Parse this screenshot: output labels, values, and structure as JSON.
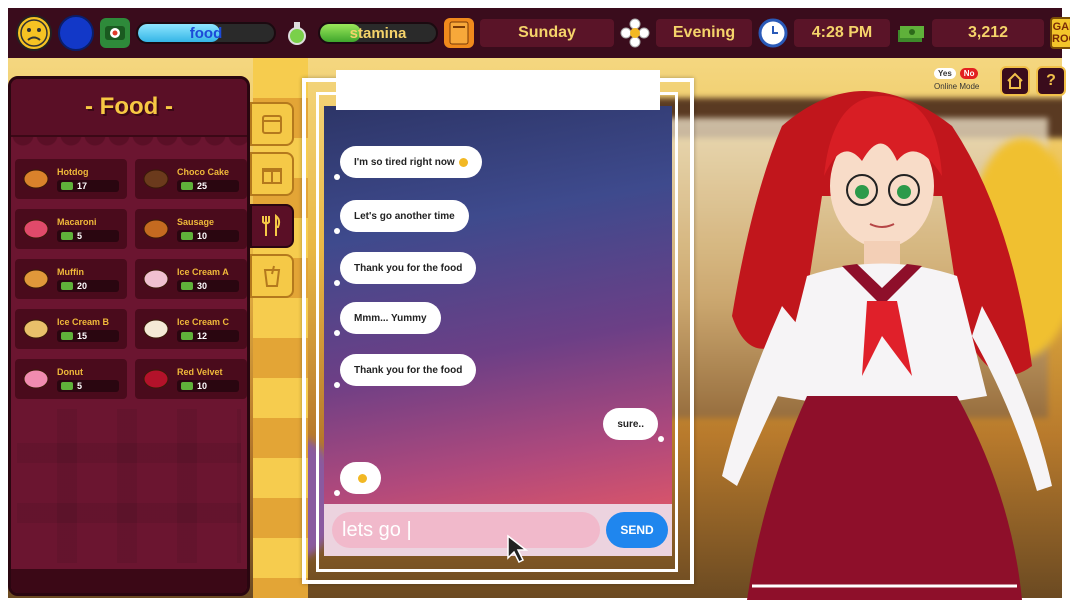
{
  "topbar": {
    "mood_icon": "sad-face-icon",
    "heart_icon": "heart-icon",
    "food_label": "food",
    "food_level": 0.6,
    "stamina_label": "stamina",
    "stamina_level": 0.35,
    "day": "Sunday",
    "time_of_day": "Evening",
    "clock": "4:28 PM",
    "money": "3,212",
    "game_room_line1": "GAME",
    "game_room_line2": "ROOM"
  },
  "food_panel": {
    "title": "- Food -",
    "items": [
      {
        "name": "Hotdog",
        "price": "17",
        "icon": "hotdog-icon"
      },
      {
        "name": "Choco Cake",
        "price": "25",
        "icon": "cake-icon"
      },
      {
        "name": "Macaroni",
        "price": "5",
        "icon": "macaron-icon"
      },
      {
        "name": "Sausage",
        "price": "10",
        "icon": "sausage-icon"
      },
      {
        "name": "Muffin",
        "price": "20",
        "icon": "muffin-icon"
      },
      {
        "name": "Ice Cream A",
        "price": "30",
        "icon": "ice-cream-cup-icon"
      },
      {
        "name": "Ice Cream B",
        "price": "15",
        "icon": "ice-cream-cone-icon"
      },
      {
        "name": "Ice Cream C",
        "price": "12",
        "icon": "soft-serve-icon"
      },
      {
        "name": "Donut",
        "price": "5",
        "icon": "donut-icon"
      },
      {
        "name": "Red Velvet",
        "price": "10",
        "icon": "roll-cake-icon"
      }
    ]
  },
  "chat": {
    "messages": [
      {
        "text": "I'm so tired right now",
        "side": "left",
        "emoji": true
      },
      {
        "text": "Let's go another time",
        "side": "left",
        "emoji": false
      },
      {
        "text": "Thank you for the food",
        "side": "left",
        "emoji": false
      },
      {
        "text": "Mmm... Yummy",
        "side": "left",
        "emoji": false
      },
      {
        "text": "Thank you for the food",
        "side": "left",
        "emoji": false
      },
      {
        "text": "sure..",
        "side": "right",
        "emoji": false
      },
      {
        "text": "",
        "side": "left",
        "emoji": true
      }
    ],
    "input_value": "lets go |",
    "send_label": "SEND"
  },
  "online_mode": {
    "yes": "Yes",
    "no": "No",
    "label": "Online Mode"
  },
  "corner": {
    "home_icon": "home-icon",
    "help_label": "?"
  },
  "colors": {
    "panel": "#6b1530",
    "accent": "#f5c947",
    "send": "#1f86ee"
  }
}
